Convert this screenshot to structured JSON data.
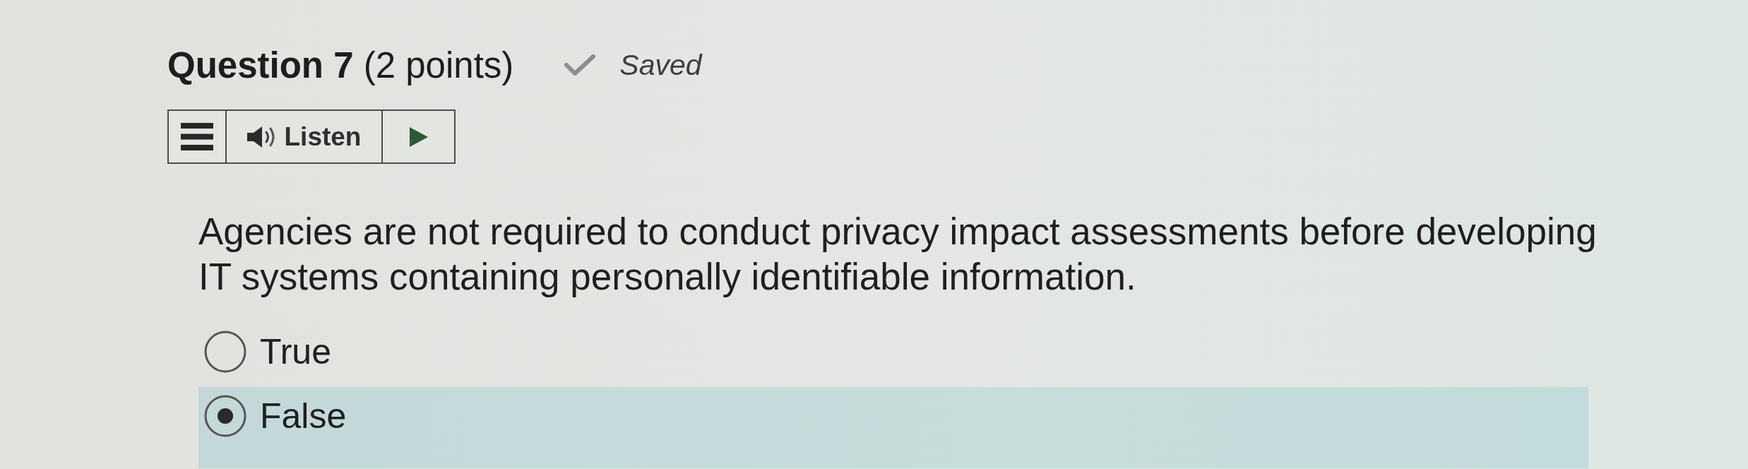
{
  "question": {
    "title": "**Question 7** (2 points)",
    "status": {
      "label": "Saved"
    }
  },
  "listen_toolbar": {
    "label": "Listen"
  },
  "prompt": "Agencies are not required to conduct privacy impact assessments before developing IT systems containing personally identifiable information.",
  "options": [
    {
      "label": "True",
      "selected": false
    },
    {
      "label": "False",
      "selected": true
    }
  ]
}
